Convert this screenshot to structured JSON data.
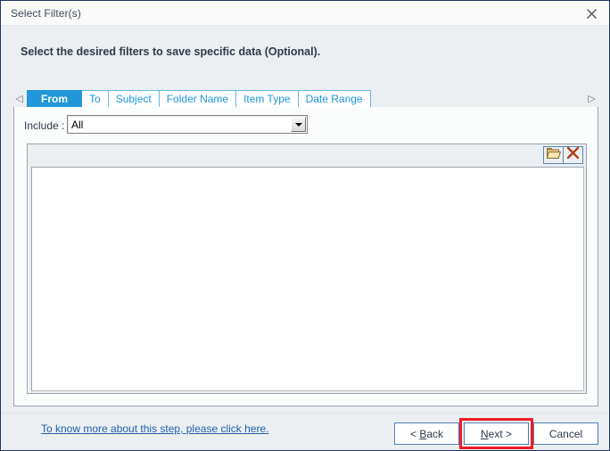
{
  "window": {
    "title": "Select Filter(s)",
    "close_icon": "close-icon",
    "border_color": "#1f3864"
  },
  "instruction": "Select the desired filters to save specific data (Optional).",
  "tabs": {
    "scroll_left_icon": "◁",
    "scroll_right_icon": "▷",
    "items": [
      {
        "label": "From",
        "active": true
      },
      {
        "label": "To",
        "active": false
      },
      {
        "label": "Subject",
        "active": false
      },
      {
        "label": "Folder Name",
        "active": false
      },
      {
        "label": "Item Type",
        "active": false
      },
      {
        "label": "Date Range",
        "active": false
      }
    ],
    "accent_color": "#2196d8"
  },
  "filter_panel": {
    "include_label": "Include :",
    "include_value": "All",
    "include_options": [
      "All"
    ],
    "toolbar": {
      "browse_icon": "folder-open-icon",
      "remove_icon": "red-x-icon"
    },
    "list_items": []
  },
  "footer": {
    "help_link": "To know more about this step, please click here.",
    "buttons": [
      {
        "name": "back",
        "prefix": "< ",
        "accel": "B",
        "suffix": "ack",
        "highlighted": false
      },
      {
        "name": "next",
        "prefix": "",
        "accel": "N",
        "suffix": "ext >",
        "highlighted": true
      },
      {
        "name": "cancel",
        "prefix": "",
        "accel": "",
        "suffix": "Cancel",
        "highlighted": false
      }
    ],
    "highlight_color": "#ee1c25"
  }
}
